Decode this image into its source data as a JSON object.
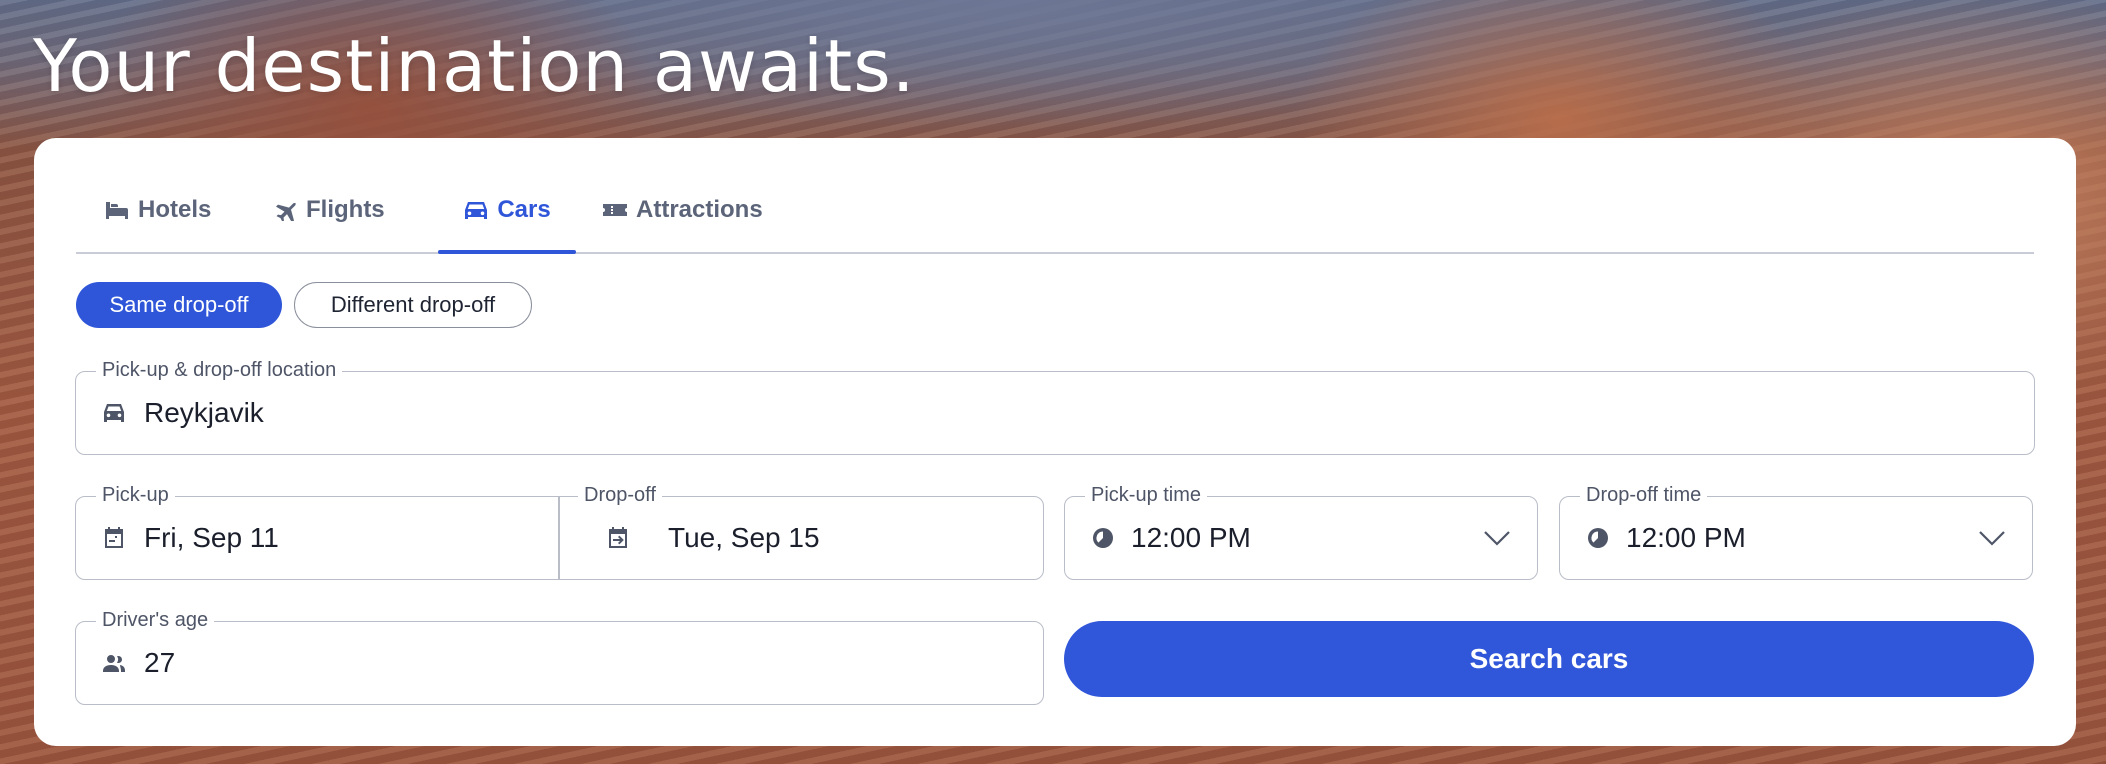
{
  "hero": {
    "headline": "Your destination awaits."
  },
  "tabs": [
    {
      "label": "Hotels",
      "icon": "bed-icon",
      "active": false
    },
    {
      "label": "Flights",
      "icon": "plane-icon",
      "active": false
    },
    {
      "label": "Cars",
      "icon": "car-icon",
      "active": true
    },
    {
      "label": "Attractions",
      "icon": "ticket-icon",
      "active": false
    }
  ],
  "dropoff_options": {
    "same": "Same drop-off",
    "different": "Different drop-off",
    "selected": "same"
  },
  "location": {
    "label": "Pick-up & drop-off location",
    "value": "Reykjavik",
    "icon": "car-icon"
  },
  "dates": {
    "pickup_label": "Pick-up",
    "pickup_value": "Fri, Sep 11",
    "pickup_icon": "calendar-icon",
    "dropoff_label": "Drop-off",
    "dropoff_value": "Tue, Sep 15",
    "dropoff_icon": "calendar-return-icon"
  },
  "pickup_time": {
    "label": "Pick-up time",
    "value": "12:00 PM",
    "icon": "clock-icon"
  },
  "dropoff_time": {
    "label": "Drop-off time",
    "value": "12:00 PM",
    "icon": "clock-icon"
  },
  "driver_age": {
    "label": "Driver's age",
    "value": "27",
    "icon": "users-icon"
  },
  "search": {
    "label": "Search cars"
  },
  "colors": {
    "accent": "#2f56d9",
    "text": "#1b1f2c",
    "muted": "#4e5567",
    "border": "#b9bdc8"
  }
}
